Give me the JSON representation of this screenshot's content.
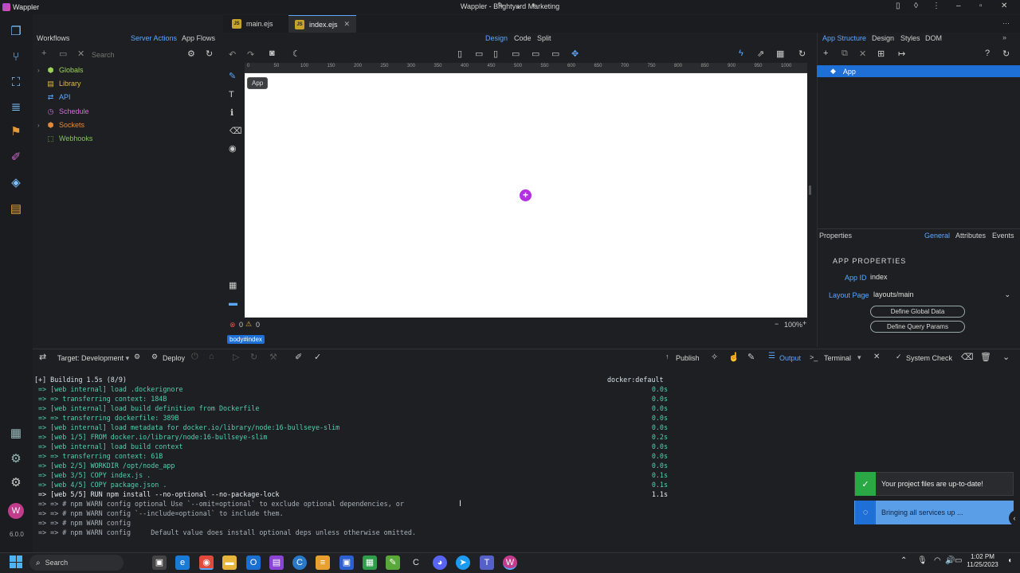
{
  "window": {
    "app_name": "Wappler",
    "title": "Wappler - Brightyard Marketing"
  },
  "version": "6.0.0",
  "workflows": {
    "title": "Workflows",
    "tabs": [
      "Server Actions",
      "App Flows"
    ],
    "search_placeholder": "Search",
    "items": [
      {
        "label": "Globals",
        "icon": "globe-icon",
        "color": "#9bd35a"
      },
      {
        "label": "Library",
        "icon": "library-icon",
        "color": "#e2b74a"
      },
      {
        "label": "API",
        "icon": "api-icon",
        "color": "#5ca8ff"
      },
      {
        "label": "Schedule",
        "icon": "clock-icon",
        "color": "#d070d8"
      },
      {
        "label": "Sockets",
        "icon": "sockets-icon",
        "color": "#e28a3b"
      },
      {
        "label": "Webhooks",
        "icon": "webhook-icon",
        "color": "#88c060"
      }
    ]
  },
  "doc_tabs": [
    {
      "label": "main.ejs",
      "active": false
    },
    {
      "label": "index.ejs",
      "active": true
    }
  ],
  "view_modes": [
    "Design",
    "Code",
    "Split"
  ],
  "ruler_ticks": [
    "0",
    "50",
    "100",
    "150",
    "200",
    "250",
    "300",
    "350",
    "400",
    "450",
    "500",
    "550",
    "600",
    "650",
    "700",
    "750",
    "800",
    "850",
    "900",
    "950",
    "1000"
  ],
  "canvas": {
    "tooltip": "App",
    "selection": "body#index",
    "zoom": "100%",
    "errors": "0",
    "warnings": "0"
  },
  "right_panel": {
    "tabs": [
      "App Structure",
      "Design",
      "Styles",
      "DOM"
    ],
    "tree_root": "App",
    "properties": {
      "title": "Properties",
      "tabs": [
        "General",
        "Attributes",
        "Events"
      ],
      "section": "APP PROPERTIES",
      "app_id_label": "App ID",
      "app_id": "index",
      "layout_label": "Layout Page",
      "layout_value": "layouts/main",
      "buttons": [
        "Define Global Data",
        "Define Query Params"
      ]
    }
  },
  "bottom_toolbar": {
    "target": "Target: Development",
    "deploy": "Deploy",
    "publish": "Publish",
    "output": "Output",
    "terminal": "Terminal",
    "system_check": "System Check"
  },
  "terminal": {
    "header": "[+] Building 1.5s (8/9)",
    "header_right": "docker:default",
    "lines": [
      {
        "text": " => [web internal] load .dockerignore",
        "time": "0.0s",
        "bright": false
      },
      {
        "text": " => => transferring context: 184B",
        "time": "0.0s",
        "bright": false
      },
      {
        "text": " => [web internal] load build definition from Dockerfile",
        "time": "0.0s",
        "bright": false
      },
      {
        "text": " => => transferring dockerfile: 389B",
        "time": "0.0s",
        "bright": false
      },
      {
        "text": " => [web internal] load metadata for docker.io/library/node:16-bullseye-slim",
        "time": "0.0s",
        "bright": false
      },
      {
        "text": " => [web 1/5] FROM docker.io/library/node:16-bullseye-slim",
        "time": "0.2s",
        "bright": false
      },
      {
        "text": " => [web internal] load build context",
        "time": "0.0s",
        "bright": false
      },
      {
        "text": " => => transferring context: 61B",
        "time": "0.0s",
        "bright": false
      },
      {
        "text": " => [web 2/5] WORKDIR /opt/node_app",
        "time": "0.0s",
        "bright": false
      },
      {
        "text": " => [web 3/5] COPY index.js .",
        "time": "0.1s",
        "bright": false
      },
      {
        "text": " => [web 4/5] COPY package.json .",
        "time": "0.1s",
        "bright": false
      },
      {
        "text": " => [web 5/5] RUN npm install --no-optional --no-package-lock",
        "time": "1.1s",
        "bright": true
      },
      {
        "text": " => => # npm WARN config optional Use `--omit=optional` to exclude optional dependencies, or",
        "time": "",
        "bright": false,
        "dim": true
      },
      {
        "text": " => => # npm WARN config `--include=optional` to include them.",
        "time": "",
        "bright": false,
        "dim": true
      },
      {
        "text": " => => # npm WARN config",
        "time": "",
        "bright": false,
        "dim": true
      },
      {
        "text": " => => # npm WARN config     Default value does install optional deps unless otherwise omitted.",
        "time": "",
        "bright": false,
        "dim": true
      }
    ]
  },
  "toasts": [
    {
      "text": "Your project files are up-to-date!",
      "color": "#2aa844",
      "icon": "check-icon"
    },
    {
      "text": "Bringing all services up ...",
      "color": "#1e6fd6",
      "icon": "spinner-icon"
    }
  ],
  "taskbar": {
    "search": "Search",
    "time": "1:02 PM",
    "date": "11/25/2023"
  }
}
